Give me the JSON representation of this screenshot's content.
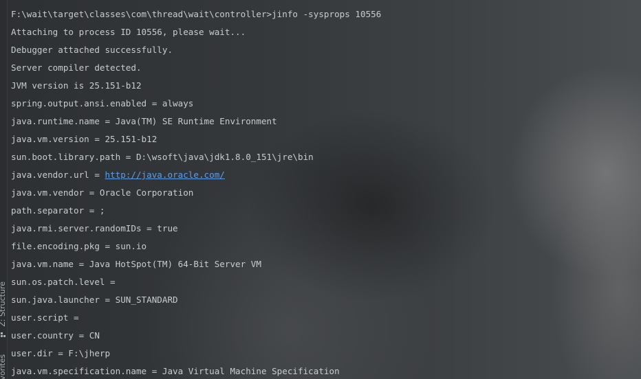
{
  "side_panel": {
    "structure_label": "Z: Structure",
    "favorites_label": "vorites"
  },
  "console": {
    "lines": [
      "F:\\wait\\target\\classes\\com\\thread\\wait\\controller>jinfo -sysprops 10556",
      "Attaching to process ID 10556, please wait...",
      "Debugger attached successfully.",
      "Server compiler detected.",
      "JVM version is 25.151-b12",
      "spring.output.ansi.enabled = always",
      "java.runtime.name = Java(TM) SE Runtime Environment",
      "java.vm.version = 25.151-b12",
      "sun.boot.library.path = D:\\wsoft\\java\\jdk1.8.0_151\\jre\\bin",
      {
        "prefix": "java.vendor.url = ",
        "link": "http://java.oracle.com/"
      },
      "java.vm.vendor = Oracle Corporation",
      "path.separator = ;",
      "java.rmi.server.randomIDs = true",
      "file.encoding.pkg = sun.io",
      "java.vm.name = Java HotSpot(TM) 64-Bit Server VM",
      "sun.os.patch.level = ",
      "sun.java.launcher = SUN_STANDARD",
      "user.script = ",
      "user.country = CN",
      "user.dir = F:\\jherp",
      "java.vm.specification.name = Java Virtual Machine Specification"
    ]
  }
}
